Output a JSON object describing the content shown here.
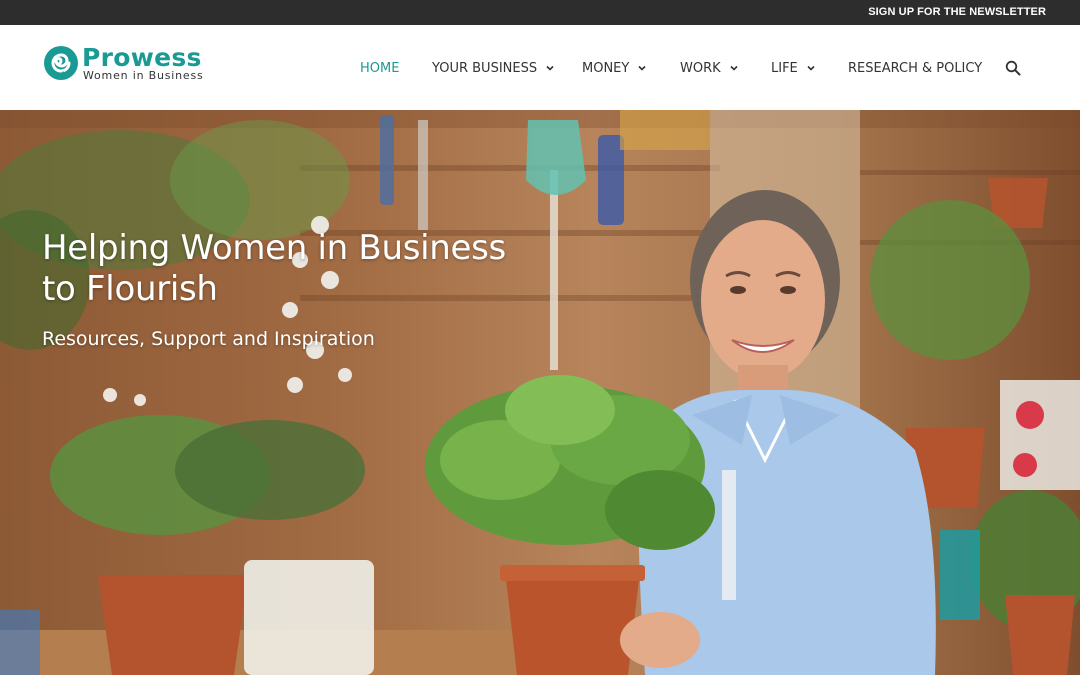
{
  "topbar": {
    "newsletter_link": "SIGN UP FOR THE NEWSLETTER"
  },
  "logo": {
    "brand": "Prowess",
    "tagline": "Women in Business"
  },
  "nav": {
    "items": [
      {
        "label": "HOME",
        "active": true,
        "has_dropdown": false
      },
      {
        "label": "YOUR BUSINESS",
        "active": false,
        "has_dropdown": true
      },
      {
        "label": "MONEY",
        "active": false,
        "has_dropdown": true
      },
      {
        "label": "WORK",
        "active": false,
        "has_dropdown": true
      },
      {
        "label": "LIFE",
        "active": false,
        "has_dropdown": true
      },
      {
        "label": "RESEARCH & POLICY",
        "active": false,
        "has_dropdown": false
      }
    ],
    "search_icon": "search-icon"
  },
  "hero": {
    "title_line1": "Helping Women in Business",
    "title_line2": "to Flourish",
    "subtitle": "Resources, Support and Inspiration",
    "image": "woman-holding-potted-plant-in-garden-shop"
  },
  "colors": {
    "accent": "#1a9a95",
    "topbar": "#2d2d2d",
    "text": "#333333"
  }
}
